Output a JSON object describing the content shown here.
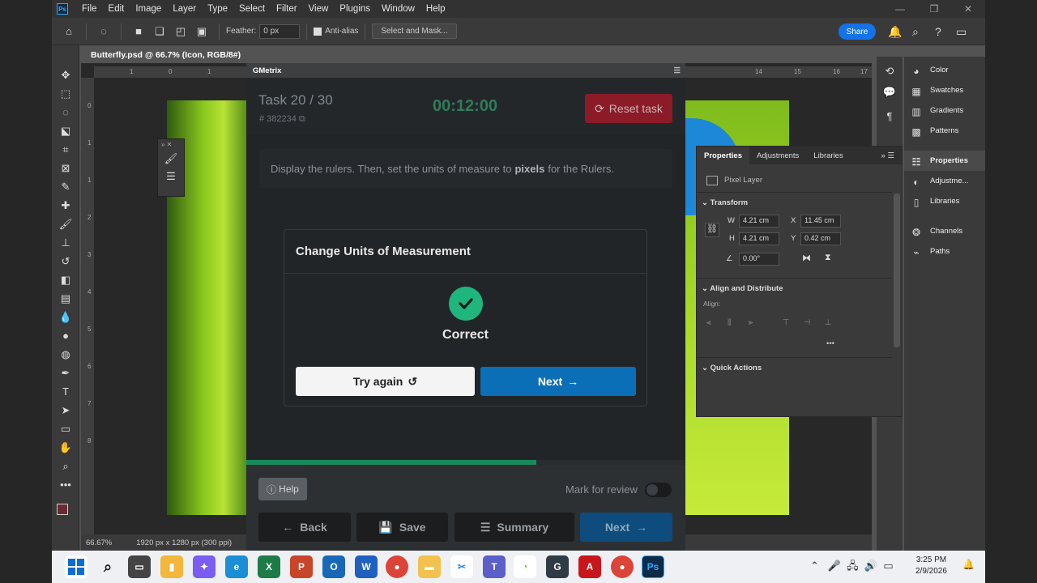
{
  "menu": {
    "app_logo": "Ps",
    "items": [
      "File",
      "Edit",
      "Image",
      "Layer",
      "Type",
      "Select",
      "Filter",
      "View",
      "Plugins",
      "Window",
      "Help"
    ]
  },
  "options": {
    "feather_label": "Feather:",
    "feather_value": "0 px",
    "antialias_label": "Anti-alias",
    "select_mask_label": "Select and Mask...",
    "share_label": "Share"
  },
  "document": {
    "tab_title": "Butterfly.psd @ 66.7% (Icon, RGB/8#)",
    "zoom": "66.67%",
    "doc_info": "1920 px x 1280 px (300 ppi)",
    "ruler_top": [
      "1",
      "0",
      "1",
      "14",
      "15",
      "16",
      "17"
    ],
    "ruler_left": [
      "0",
      "1",
      "1",
      "2",
      "3",
      "4",
      "5",
      "6",
      "7",
      "8",
      "9"
    ]
  },
  "right_panels": {
    "group1": [
      "Color",
      "Swatches",
      "Gradients",
      "Patterns"
    ],
    "group2": [
      "Properties",
      "Adjustme...",
      "Libraries"
    ],
    "group3": [
      "Channels",
      "Paths"
    ]
  },
  "properties": {
    "tabs": [
      "Properties",
      "Adjustments",
      "Libraries"
    ],
    "layer_type": "Pixel Layer",
    "transform_title": "Transform",
    "w_label": "W",
    "w_value": "4.21 cm",
    "x_label": "X",
    "x_value": "11.45 cm",
    "h_label": "H",
    "h_value": "4.21 cm",
    "y_label": "Y",
    "y_value": "0.42 cm",
    "angle_value": "0.00°",
    "align_title": "Align and Distribute",
    "align_label": "Align:",
    "quick_actions": "Quick Actions"
  },
  "gmetrix": {
    "title": "GMetrix",
    "task": "Task 20 / 30",
    "task_id": "# 382234",
    "timer": "00:12:00",
    "reset_label": "Reset task",
    "instruction_pre": "Display the rulers. Then, set the units of measure to",
    "instruction_bold": "pixels",
    "instruction_post": "for the Rulers.",
    "card_title": "Change Units of Measurement",
    "result": "Correct",
    "try_again": "Try again",
    "card_next": "Next",
    "progress": 0.66,
    "help": "Help",
    "mark_review": "Mark for review",
    "back": "Back",
    "save": "Save",
    "summary": "Summary",
    "next": "Next"
  },
  "taskbar": {
    "time": "3:25 PM",
    "date": "2/9/2026"
  },
  "colors": {
    "accent": "#0b6fb8",
    "success": "#1eb67d",
    "danger": "#8c1b28",
    "share": "#1473e6"
  }
}
